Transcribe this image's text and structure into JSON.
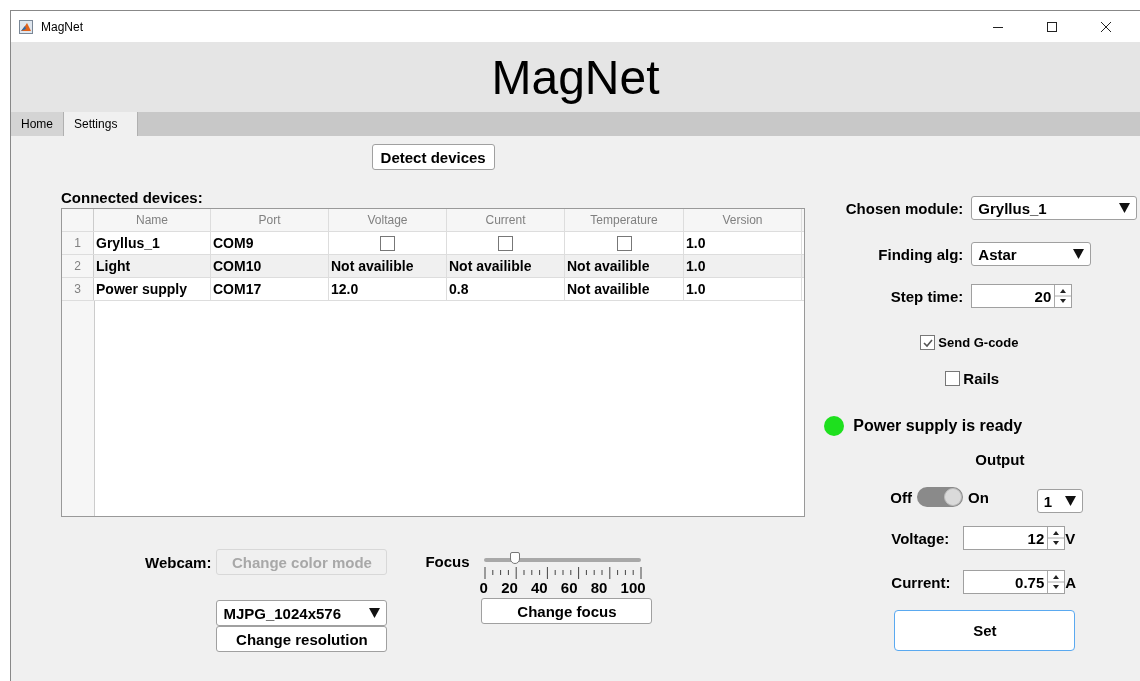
{
  "window": {
    "title": "MagNet"
  },
  "header": {
    "title": "MagNet"
  },
  "tabs": [
    {
      "label": "Home",
      "selected": false
    },
    {
      "label": "Settings",
      "selected": true
    }
  ],
  "detect_button": "Detect devices",
  "devices": {
    "label": "Connected devices:",
    "columns": [
      "Name",
      "Port",
      "Voltage",
      "Current",
      "Temperature",
      "Version"
    ],
    "rows": [
      {
        "index": "1",
        "cells": [
          {
            "kind": "text",
            "text": "Gryllus_1"
          },
          {
            "kind": "text",
            "text": "COM9"
          },
          {
            "kind": "checkbox",
            "checked": false
          },
          {
            "kind": "checkbox",
            "checked": false
          },
          {
            "kind": "checkbox",
            "checked": false
          },
          {
            "kind": "text",
            "text": "1.0"
          }
        ]
      },
      {
        "index": "2",
        "cells": [
          {
            "kind": "text",
            "text": "Light"
          },
          {
            "kind": "text",
            "text": "COM10"
          },
          {
            "kind": "text",
            "text": "Not availible"
          },
          {
            "kind": "text",
            "text": "Not availible"
          },
          {
            "kind": "text",
            "text": "Not availible"
          },
          {
            "kind": "text",
            "text": "1.0"
          }
        ]
      },
      {
        "index": "3",
        "cells": [
          {
            "kind": "text",
            "text": "Power supply"
          },
          {
            "kind": "text",
            "text": "COM17"
          },
          {
            "kind": "text",
            "text": "12.0"
          },
          {
            "kind": "text",
            "text": "0.8"
          },
          {
            "kind": "text",
            "text": "Not availible"
          },
          {
            "kind": "text",
            "text": "1.0"
          }
        ]
      }
    ]
  },
  "webcam": {
    "label": "Webcam:",
    "color_mode_button": {
      "label": "Change color mode",
      "disabled": true
    },
    "resolution": {
      "value": "MJPG_1024x576"
    },
    "resolution_button": "Change resolution"
  },
  "focus": {
    "label": "Focus",
    "level": 0.2,
    "ticks": [
      "0",
      "20",
      "40",
      "60",
      "80",
      "100"
    ],
    "button": "Change focus"
  },
  "chosen_module": {
    "label": "Chosen module:",
    "value": "Gryllus_1"
  },
  "finding_alg": {
    "label": "Finding alg:",
    "value": "Astar"
  },
  "step_time": {
    "label": "Step time:",
    "value": "20"
  },
  "send_gcode": {
    "label": "Send G-code",
    "checked": true
  },
  "rails": {
    "label": "Rails",
    "checked": false
  },
  "status": {
    "text": "Power supply is ready",
    "color": "#1ee01e"
  },
  "output": {
    "label": "Output",
    "off_label": "Off",
    "on_label": "On",
    "on": true,
    "channel": "1"
  },
  "voltage": {
    "label": "Voltage:",
    "value": "12",
    "unit": "V"
  },
  "current": {
    "label": "Current:",
    "value": "0.75",
    "unit": "A"
  },
  "set_button": "Set"
}
